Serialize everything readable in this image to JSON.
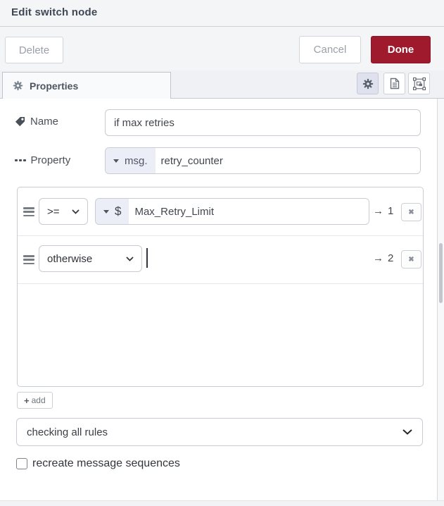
{
  "header": {
    "title": "Edit switch node"
  },
  "actions": {
    "delete": "Delete",
    "cancel": "Cancel",
    "done": "Done"
  },
  "tabs": {
    "properties": "Properties"
  },
  "toolbar": {
    "icons": [
      "gear-icon",
      "description-icon",
      "appearance-icon"
    ]
  },
  "form": {
    "name_label": "Name",
    "name_value": "if max retries",
    "property_label": "Property",
    "property_type": "msg.",
    "property_value": "retry_counter",
    "rules": [
      {
        "operator": ">=",
        "value_type": "$",
        "value": "Max_Retry_Limit",
        "arrow": "→",
        "output": "1"
      },
      {
        "operator": "otherwise",
        "arrow": "→",
        "output": "2"
      }
    ],
    "remove_glyph": "✖",
    "add_plus": "+",
    "add_label": "add",
    "mode_value": "checking all rules",
    "recreate_label": "recreate message sequences",
    "recreate_checked": false
  },
  "colors": {
    "accent": "#9e1a2c",
    "typed_button_bg": "#eceef7",
    "active_tool_bg": "#dfe2ee",
    "header_bg": "#f4f5f7"
  }
}
